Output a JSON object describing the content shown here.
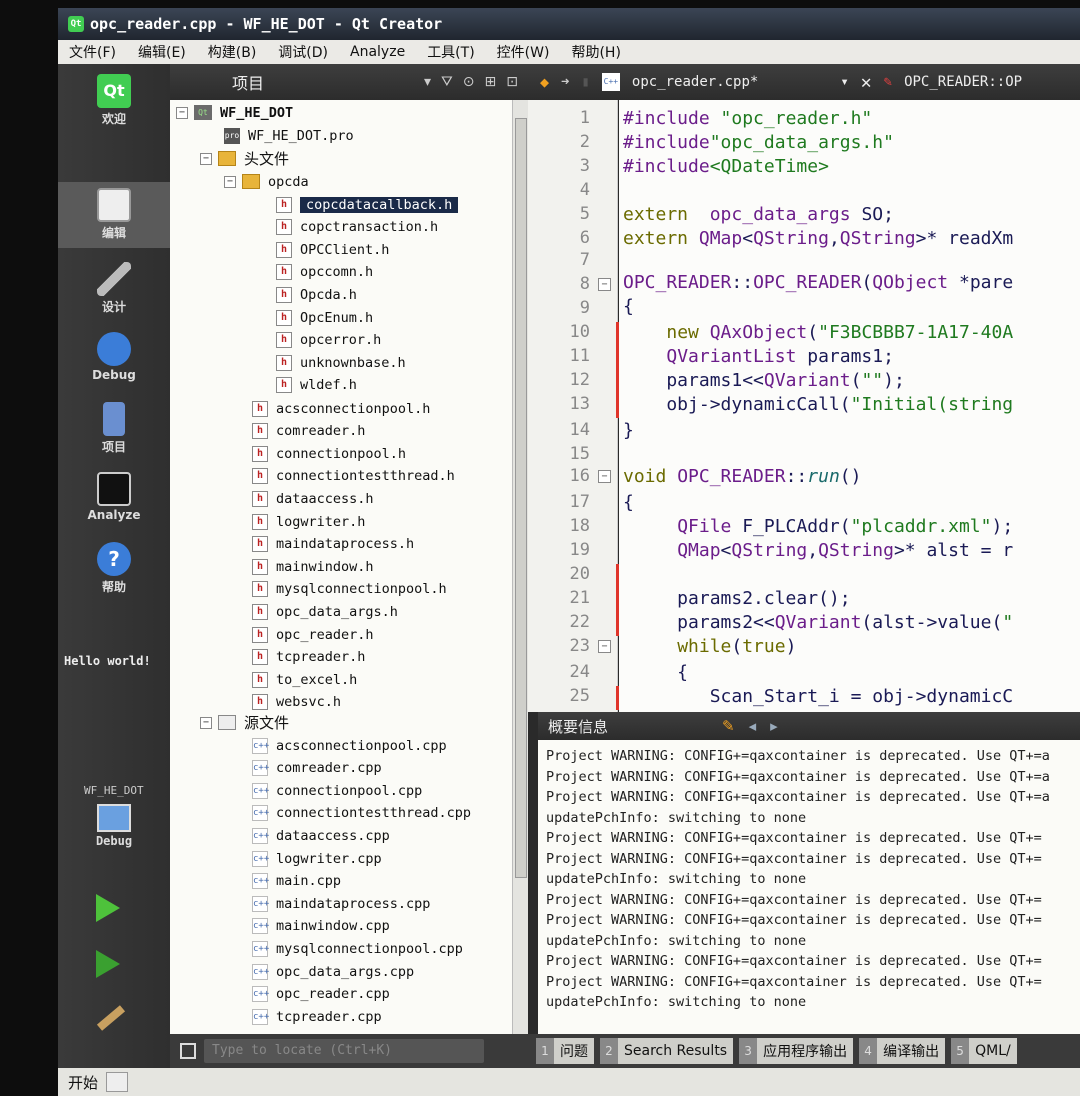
{
  "window": {
    "title": "opc_reader.cpp - WF_HE_DOT - Qt Creator",
    "logo": "Qt"
  },
  "menu": [
    "文件(F)",
    "编辑(E)",
    "构建(B)",
    "调试(D)",
    "Analyze",
    "工具(T)",
    "控件(W)",
    "帮助(H)"
  ],
  "modes": {
    "welcome": "欢迎",
    "edit": "编辑",
    "design": "设计",
    "debug": "Debug",
    "projects": "项目",
    "analyze": "Analyze",
    "help": "帮助"
  },
  "hello": "Hello world!",
  "project_selector": {
    "name": "WF_HE_DOT",
    "mode": "Debug"
  },
  "project_panel": {
    "title": "项目"
  },
  "tree": {
    "root": "WF_HE_DOT",
    "pro": "WF_HE_DOT.pro",
    "headers_label": "头文件",
    "opcda_label": "opcda",
    "opcda_files": [
      "copcdatacallback.h",
      "copctransaction.h",
      "OPCClient.h",
      "opccomn.h",
      "Opcda.h",
      "OpcEnum.h",
      "opcerror.h",
      "unknownbase.h",
      "wldef.h"
    ],
    "header_files": [
      "acsconnectionpool.h",
      "comreader.h",
      "connectionpool.h",
      "connectiontestthread.h",
      "dataaccess.h",
      "logwriter.h",
      "maindataprocess.h",
      "mainwindow.h",
      "mysqlconnectionpool.h",
      "opc_data_args.h",
      "opc_reader.h",
      "tcpreader.h",
      "to_excel.h",
      "websvc.h"
    ],
    "sources_label": "源文件",
    "source_files": [
      "acsconnectionpool.cpp",
      "comreader.cpp",
      "connectionpool.cpp",
      "connectiontestthread.cpp",
      "dataaccess.cpp",
      "logwriter.cpp",
      "main.cpp",
      "maindataprocess.cpp",
      "mainwindow.cpp",
      "mysqlconnectionpool.cpp",
      "opc_data_args.cpp",
      "opc_reader.cpp",
      "tcpreader.cpp"
    ],
    "selected": "copcdatacallback.h"
  },
  "locate": {
    "placeholder": "Type to locate (Ctrl+K)"
  },
  "editor": {
    "tab": "opc_reader.cpp*",
    "symbol": "OPC_READER::OP",
    "line_numbers": [
      "1",
      "2",
      "3",
      "4",
      "5",
      "6",
      "7",
      "8",
      "9",
      "10",
      "11",
      "12",
      "13",
      "14",
      "15",
      "16",
      "17",
      "18",
      "19",
      "20",
      "21",
      "22",
      "23",
      "24",
      "25"
    ]
  },
  "output": {
    "title": "概要信息",
    "lines": [
      "Project WARNING: CONFIG+=qaxcontainer is deprecated. Use QT+=a",
      "Project WARNING: CONFIG+=qaxcontainer is deprecated. Use QT+=a",
      "Project WARNING: CONFIG+=qaxcontainer is deprecated. Use QT+=a",
      "updatePchInfo: switching to none",
      "Project WARNING: CONFIG+=qaxcontainer is deprecated. Use QT+=",
      "Project WARNING: CONFIG+=qaxcontainer is deprecated. Use QT+=",
      "updatePchInfo: switching to none",
      "Project WARNING: CONFIG+=qaxcontainer is deprecated. Use QT+=",
      "Project WARNING: CONFIG+=qaxcontainer is deprecated. Use QT+=",
      "updatePchInfo: switching to none",
      "Project WARNING: CONFIG+=qaxcontainer is deprecated. Use QT+=",
      "Project WARNING: CONFIG+=qaxcontainer is deprecated. Use QT+=",
      "updatePchInfo: switching to none"
    ]
  },
  "panes": [
    {
      "n": "1",
      "label": "问题"
    },
    {
      "n": "2",
      "label": "Search Results"
    },
    {
      "n": "3",
      "label": "应用程序输出"
    },
    {
      "n": "4",
      "label": "编译输出"
    },
    {
      "n": "5",
      "label": "QML/"
    }
  ],
  "taskbar": {
    "start": "开始"
  },
  "colors": {
    "accent_run": "#4ec23b",
    "change_marker": "#e0352a",
    "selection": "#1a2a48"
  }
}
